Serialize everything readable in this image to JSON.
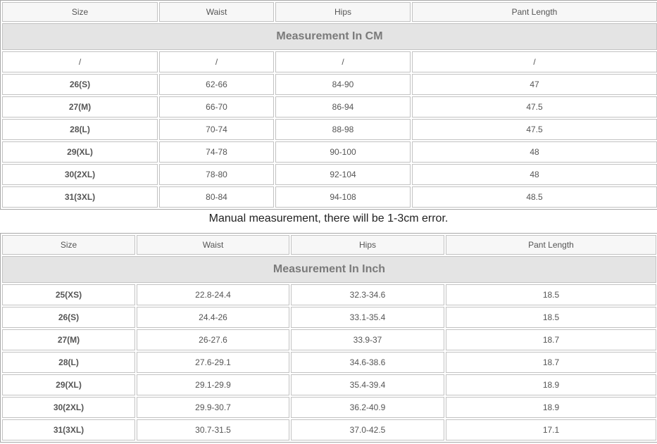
{
  "cm_table": {
    "headers": [
      "Size",
      "Waist",
      "Hips",
      "Pant Length"
    ],
    "title": "Measurement In CM",
    "rows": [
      [
        "/",
        "/",
        "/",
        "/"
      ],
      [
        "26(S)",
        "62-66",
        "84-90",
        "47"
      ],
      [
        "27(M)",
        "66-70",
        "86-94",
        "47.5"
      ],
      [
        "28(L)",
        "70-74",
        "88-98",
        "47.5"
      ],
      [
        "29(XL)",
        "74-78",
        "90-100",
        "48"
      ],
      [
        "30(2XL)",
        "78-80",
        "92-104",
        "48"
      ],
      [
        "31(3XL)",
        "80-84",
        "94-108",
        "48.5"
      ]
    ]
  },
  "note": "Manual measurement, there will be 1-3cm error.",
  "inch_table": {
    "headers": [
      "Size",
      "Waist",
      "Hips",
      "Pant Length"
    ],
    "title": "Measurement In Inch",
    "rows": [
      [
        "25(XS)",
        "22.8-24.4",
        "32.3-34.6",
        "18.5"
      ],
      [
        "26(S)",
        "24.4-26",
        "33.1-35.4",
        "18.5"
      ],
      [
        "27(M)",
        "26-27.6",
        "33.9-37",
        "18.7"
      ],
      [
        "28(L)",
        "27.6-29.1",
        "34.6-38.6",
        "18.7"
      ],
      [
        "29(XL)",
        "29.1-29.9",
        "35.4-39.4",
        "18.9"
      ],
      [
        "30(2XL)",
        "29.9-30.7",
        "36.2-40.9",
        "18.9"
      ],
      [
        "31(3XL)",
        "30.7-31.5",
        "37.0-42.5",
        "17.1"
      ]
    ]
  }
}
